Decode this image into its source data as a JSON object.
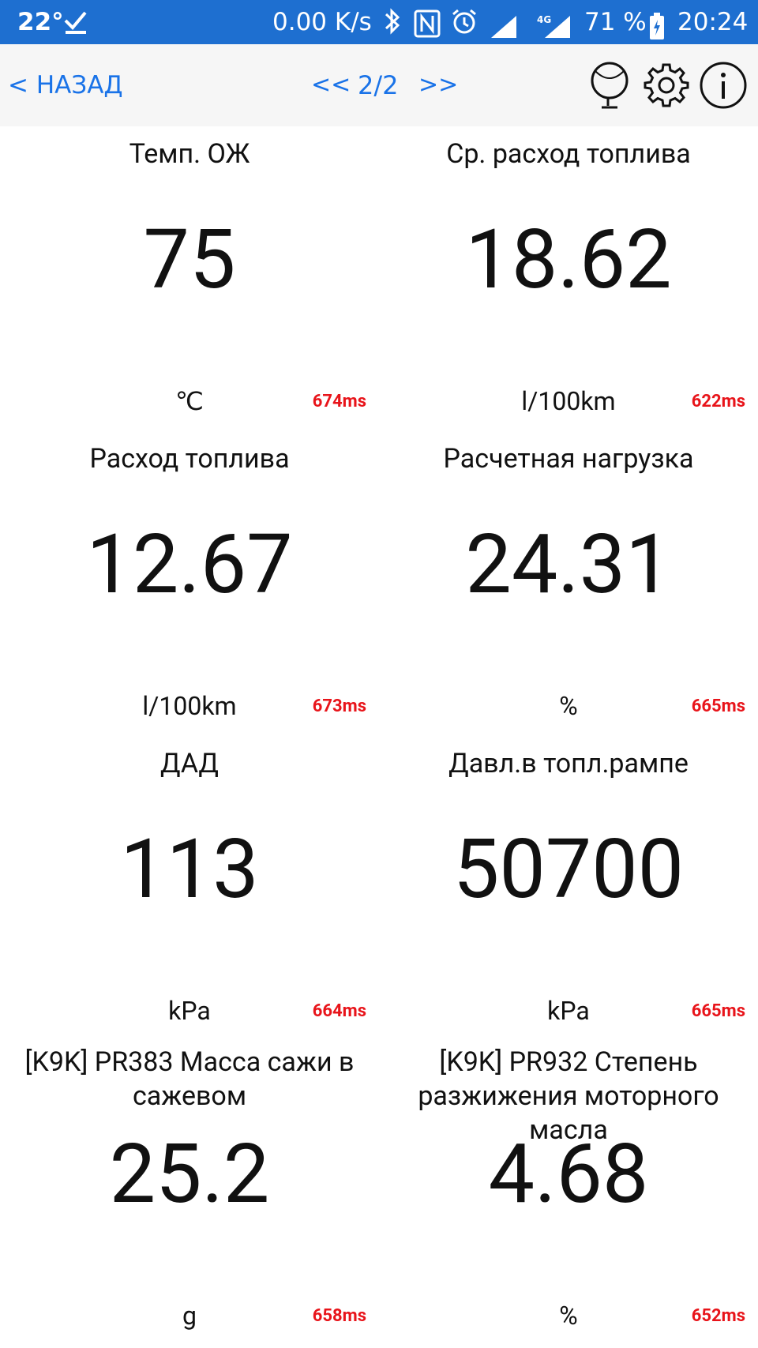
{
  "status_bar": {
    "temperature": "22°",
    "net_speed": "0.00 K/s",
    "battery_percent": "71 %",
    "clock": "20:24",
    "icons": [
      "check-icon",
      "bluetooth-icon",
      "nfc-icon",
      "alarm-icon",
      "signal-icon",
      "signal-4g-icon",
      "battery-charging-icon"
    ]
  },
  "toolbar": {
    "back_label": "< НАЗАД",
    "prev_label": "<<",
    "page_label": "2/2",
    "next_label": ">>",
    "icons": [
      "globe-icon",
      "gear-icon",
      "info-icon"
    ]
  },
  "gauges": [
    {
      "title": "Темп. ОЖ",
      "value": "75",
      "unit": "℃",
      "latency": "674ms"
    },
    {
      "title": "Ср. расход топлива",
      "value": "18.62",
      "unit": "l/100km",
      "latency": "622ms"
    },
    {
      "title": "Расход топлива",
      "value": "12.67",
      "unit": "l/100km",
      "latency": "673ms"
    },
    {
      "title": "Расчетная нагрузка",
      "value": "24.31",
      "unit": "%",
      "latency": "665ms"
    },
    {
      "title": "ДАД",
      "value": "113",
      "unit": "kPa",
      "latency": "664ms"
    },
    {
      "title": "Давл.в топл.рампе",
      "value": "50700",
      "unit": "kPa",
      "latency": "665ms"
    },
    {
      "title": "[K9K] PR383 Масса сажи в сажевом",
      "value": "25.2",
      "unit": "g",
      "latency": "658ms"
    },
    {
      "title": "[K9K] PR932 Степень разжижения моторного масла",
      "value": "4.68",
      "unit": "%",
      "latency": "652ms"
    }
  ],
  "colors": {
    "status_bar_bg": "#1e6fd0",
    "toolbar_bg": "#f6f6f6",
    "link_blue": "#1a73e8",
    "latency_red": "#e8141a"
  }
}
